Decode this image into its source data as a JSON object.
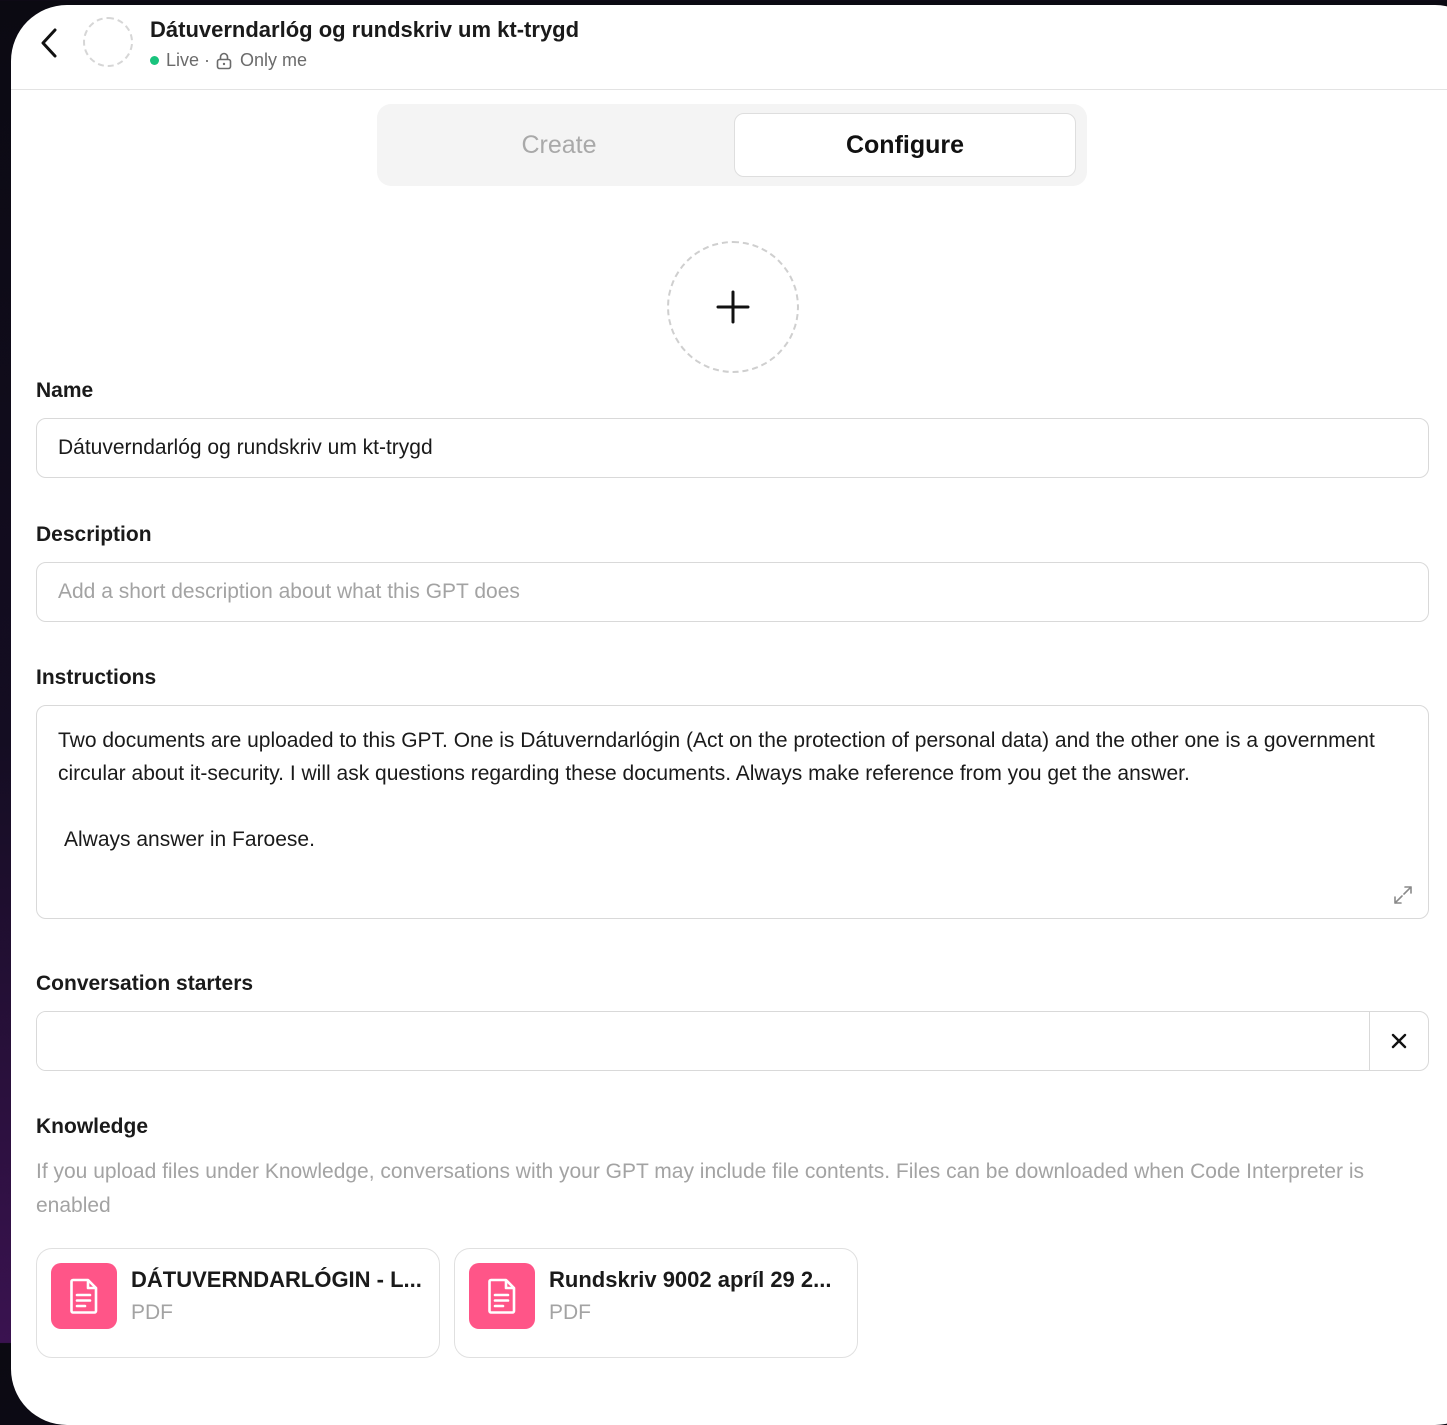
{
  "header": {
    "title": "Dátuverndarlóg og rundskriv um kt-trygd",
    "status_live": "Live",
    "separator": "·",
    "visibility": "Only me",
    "status_color": "#19c37d"
  },
  "tabs": [
    {
      "label": "Create",
      "active": false
    },
    {
      "label": "Configure",
      "active": true
    }
  ],
  "form": {
    "name": {
      "label": "Name",
      "value": "Dátuverndarlóg og rundskriv um kt-trygd"
    },
    "description": {
      "label": "Description",
      "value": "",
      "placeholder": "Add a short description about what this GPT does"
    },
    "instructions": {
      "label": "Instructions",
      "paragraph1": "Two documents are uploaded to this GPT. One is Dátuverndarlógin (Act on the protection of personal data) and the other one is a government circular  about it-security.  I will ask questions regarding these documents. Always make reference from you get the answer.",
      "paragraph2": "Always answer in Faroese."
    },
    "conversation_starters": {
      "label": "Conversation starters",
      "value": ""
    },
    "knowledge": {
      "label": "Knowledge",
      "helper": "If you upload files under Knowledge, conversations with your GPT may include file contents. Files can be downloaded when Code Interpreter is enabled",
      "files": [
        {
          "name": "DÁTUVERNDARLÓGIN - L...",
          "type": "PDF"
        },
        {
          "name": "Rundskriv 9002 apríl 29 2...",
          "type": "PDF"
        }
      ]
    }
  },
  "icons": {
    "back": "chevron-left-icon",
    "lock": "lock-icon",
    "avatar_add": "plus-icon",
    "expand": "expand-icon",
    "clear": "close-icon",
    "file": "document-icon"
  },
  "colors": {
    "file_icon_bg": "#ff5588",
    "muted_text": "#a3a3a3"
  }
}
